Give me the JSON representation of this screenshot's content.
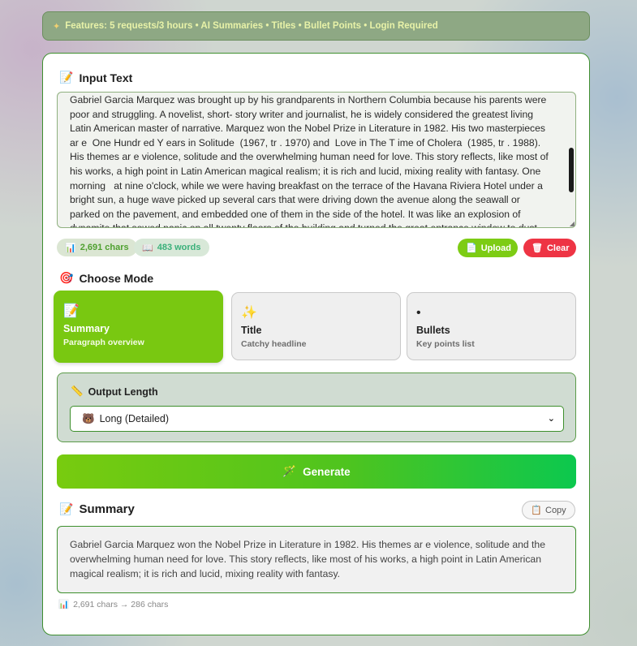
{
  "banner": {
    "icon": "sparkle-icon",
    "text": "Features: 5 requests/3 hours • AI Summaries • Titles • Bullet Points • Login Required"
  },
  "input": {
    "title": "Input Text",
    "icon": "memo-icon",
    "text": "Gabriel Garcia Marquez was brought up by his grandparents in Northern Columbia because his parents were poor and struggling. A novelist, short- story writer and journalist, he is widely considered the greatest living Latin American master of narrative. Marquez won the Nobel Prize in Literature in 1982. His two masterpieces ar e  One Hundr ed Y ears in Solitude  (1967, tr . 1970) and  Love in The T ime of Cholera  (1985, tr . 1988). His themes ar e violence, solitude and the overwhelming human need for love. This story reflects, like most of his works, a high point in Latin American magical realism; it is rich and lucid, mixing reality with fantasy. One morning   at nine o'clock, while we were having breakfast on the terrace of the Havana Riviera Hotel under a bright sun, a huge wave picked up several cars that were driving down the avenue along the seawall or parked on the pavement, and embedded one of them in the side of the hotel. It was like an explosion of dynamite that sowed panic on all twenty floors of the building and turned the great entrance window to dust. The many"
  },
  "stats": {
    "chars": "2,691 chars",
    "words": "483 words"
  },
  "actions": {
    "upload": "Upload",
    "clear": "Clear"
  },
  "mode": {
    "title": "Choose Mode",
    "options": [
      {
        "name": "Summary",
        "desc": "Paragraph overview",
        "icon": "memo-icon",
        "active": true
      },
      {
        "name": "Title",
        "desc": "Catchy headline",
        "icon": "sparkles-icon",
        "active": false
      },
      {
        "name": "Bullets",
        "desc": "Key points list",
        "icon": "bullet-icon",
        "active": false
      }
    ]
  },
  "length": {
    "label": "Output Length",
    "selected": "Long (Detailed)"
  },
  "generate": {
    "label": "Generate"
  },
  "output": {
    "title": "Summary",
    "copy": "Copy",
    "text": "Gabriel Garcia Marquez won the Nobel Prize in Literature in 1982. His themes ar e violence, solitude and the overwhelming human need for love. This story reflects, like most of his works, a high point in Latin American magical realism; it is rich and lucid, mixing reality with fantasy.",
    "stat": "2,691 chars → 286 chars"
  },
  "colors": {
    "accent_green": "#79c811",
    "danger_red": "#ee3444",
    "border_green": "#3d8f2c"
  }
}
